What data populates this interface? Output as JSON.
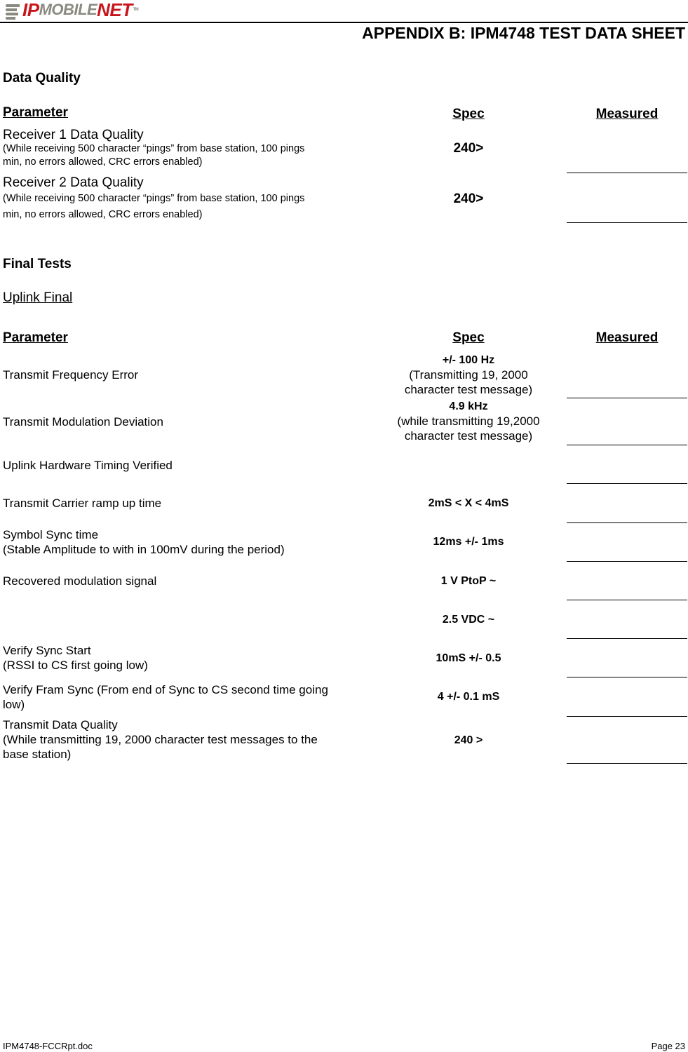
{
  "header": {
    "logo": {
      "part1": "IP",
      "part2": "MOBILE",
      "part3": "NET",
      "tm": "TM",
      "icon": "ipmobilenet-logo-icon"
    },
    "title": "APPENDIX B:  IPM4748 TEST DATA SHEET"
  },
  "data_quality": {
    "heading": "Data Quality",
    "columns": {
      "parameter": "Parameter",
      "spec": "Spec",
      "measured": "Measured"
    },
    "rows": [
      {
        "name": "Receiver 1  Data Quality",
        "note_line1": "(While receiving 500 character “pings” from base station, 100 pings",
        "note_line2": "min, no errors allowed, CRC errors enabled)",
        "spec": "240>",
        "measured": ""
      },
      {
        "name": "Receiver 2  Data Quality",
        "note_line1": "(While receiving 500 character “pings” from base station, 100 pings",
        "note_line2": "min, no errors allowed, CRC errors enabled)",
        "spec": "240>",
        "measured": ""
      }
    ]
  },
  "final_tests": {
    "heading": "Final Tests",
    "subheading": "Uplink Final",
    "columns": {
      "parameter": "Parameter",
      "spec": "Spec",
      "measured": "Measured"
    },
    "rows": [
      {
        "param_line1": "Transmit Frequency Error",
        "param_line2": "",
        "spec_bold": "+/- 100 Hz",
        "spec_line2": "(Transmitting 19, 2000",
        "spec_line3": "character test message)",
        "measured": ""
      },
      {
        "param_line1": "Transmit Modulation Deviation",
        "param_line2": "",
        "spec_bold": "4.9 kHz",
        "spec_line2": "(while transmitting 19,2000",
        "spec_line3": "character test message)",
        "measured": ""
      },
      {
        "param_line1": "Uplink Hardware Timing Verified",
        "param_line2": "",
        "spec_bold": "",
        "measured": ""
      },
      {
        "param_line1": "Transmit Carrier ramp up time",
        "param_line2": "",
        "spec_bold": "2mS < X < 4mS",
        "measured": ""
      },
      {
        "param_line1": "Symbol Sync time",
        "param_line2": "(Stable Amplitude to with in 100mV during the period)",
        "spec_bold": "12ms +/- 1ms",
        "measured": ""
      },
      {
        "param_line1": "Recovered modulation signal",
        "param_line2": "",
        "spec_bold": "1 V PtoP ~",
        "measured": ""
      },
      {
        "param_line1": "",
        "param_line2": "",
        "spec_bold": "2.5 VDC ~",
        "measured": ""
      },
      {
        "param_line1": "Verify Sync Start",
        "param_line2": "(RSSI to CS first going low)",
        "spec_bold": "10mS +/- 0.5",
        "measured": ""
      },
      {
        "param_line1": "Verify Fram Sync (From end of Sync to CS second time going",
        "param_line2": "low)",
        "spec_bold": "4 +/- 0.1 mS",
        "measured": ""
      },
      {
        "param_line1": "Transmit Data Quality",
        "param_line2": "(While transmitting 19, 2000 character test messages to the",
        "param_line3": "base station)",
        "spec_bold": "240 >",
        "measured": ""
      }
    ]
  },
  "footer": {
    "filename": "IPM4748-FCCRpt.doc",
    "page": "Page 23"
  }
}
